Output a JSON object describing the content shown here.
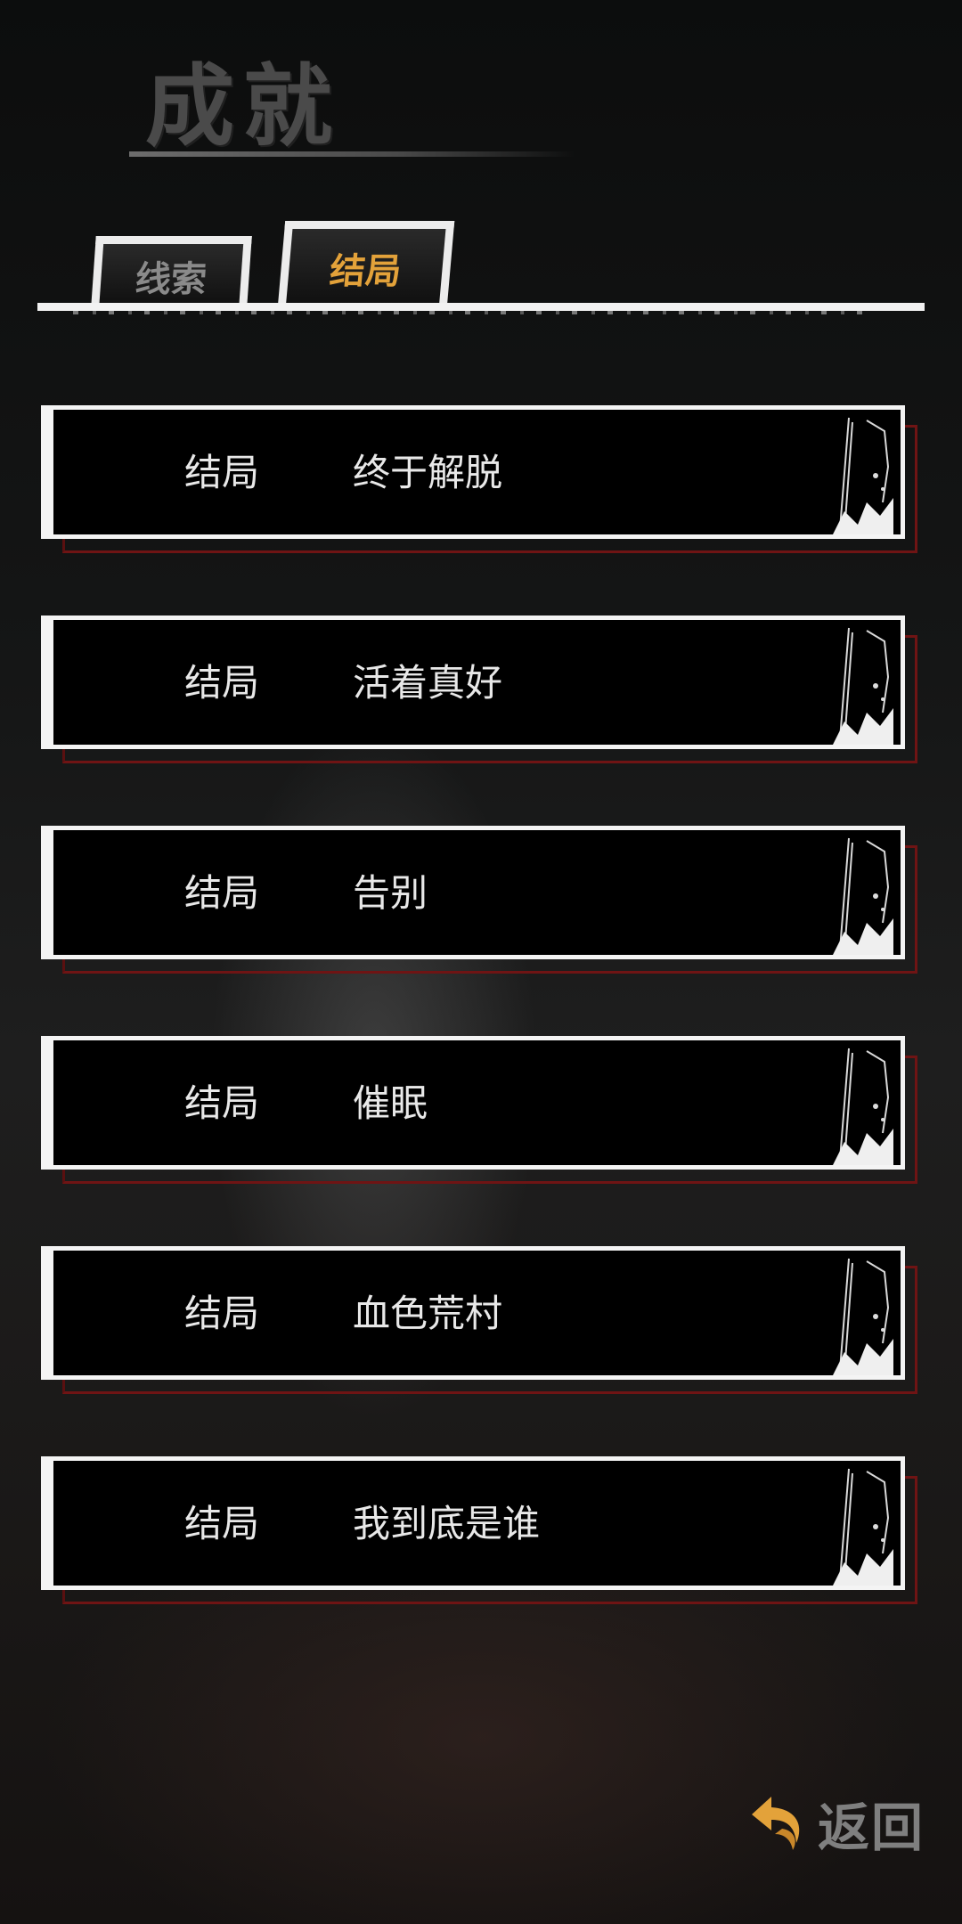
{
  "header": {
    "title": "成就"
  },
  "tabs": [
    {
      "label": "线索",
      "active": false
    },
    {
      "label": "结局",
      "active": true
    }
  ],
  "endings": [
    {
      "label": "结局",
      "name": "终于解脱"
    },
    {
      "label": "结局",
      "name": "活着真好"
    },
    {
      "label": "结局",
      "name": "告别"
    },
    {
      "label": "结局",
      "name": "催眠"
    },
    {
      "label": "结局",
      "name": "血色荒村"
    },
    {
      "label": "结局",
      "name": "我到底是谁"
    }
  ],
  "footer": {
    "back_label": "返回",
    "back_icon": "return-arrow-icon"
  },
  "colors": {
    "accent": "#e3a23a",
    "card_shadow": "#6f1414",
    "text": "#e8e8e8"
  }
}
